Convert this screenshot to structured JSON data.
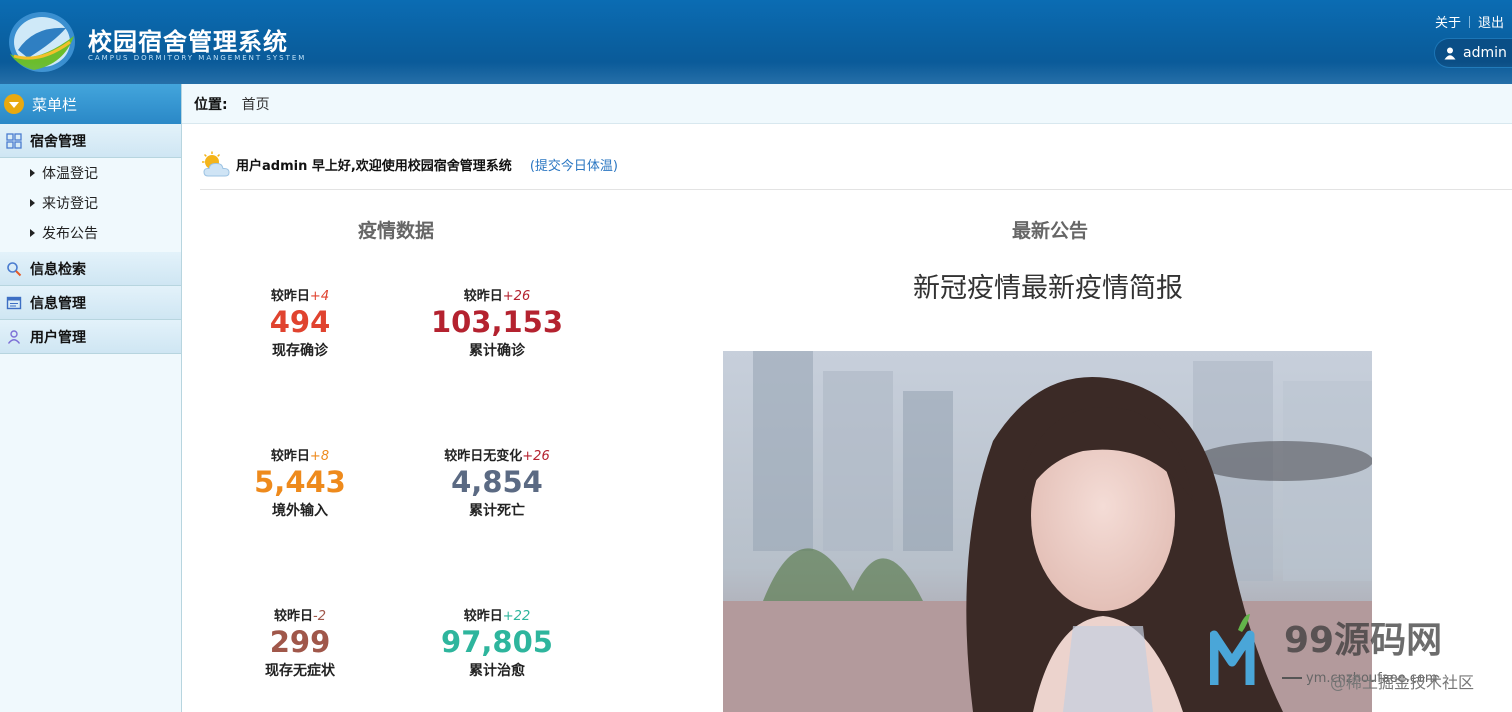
{
  "header": {
    "title": "校园宿舍管理系统",
    "subtitle": "CAMPUS DORMITORY MANGEMENT SYSTEM",
    "links": [
      "关于",
      "退出"
    ],
    "user": "admin"
  },
  "sidebar": {
    "menu_title": "菜单栏",
    "groups": [
      {
        "label": "宿舍管理",
        "items": [
          "体温登记",
          "来访登记",
          "发布公告"
        ]
      },
      {
        "label": "信息检索"
      },
      {
        "label": "信息管理"
      },
      {
        "label": "用户管理"
      }
    ]
  },
  "breadcrumb": {
    "label": "位置:",
    "value": "首页"
  },
  "greeting": {
    "message": "用户admin  早上好,欢迎使用校园宿舍管理系统",
    "link": "(提交今日体温)"
  },
  "epidemic": {
    "title": "疫情数据",
    "stats": [
      {
        "compare": "较昨日",
        "delta": "+4",
        "value": "494",
        "label": "现存确诊",
        "color": "#e0432f",
        "delta_color": "#e0432f"
      },
      {
        "compare": "较昨日",
        "delta": "+26",
        "value": "103,153",
        "label": "累计确诊",
        "color": "#b4222f",
        "delta_color": "#b4222f"
      },
      {
        "compare": "较昨日",
        "delta": "+8",
        "value": "5,443",
        "label": "境外输入",
        "color": "#ee8a1c",
        "delta_color": "#ee8a1c"
      },
      {
        "compare": "较昨日无变化",
        "delta": "+26",
        "value": "4,854",
        "label": "累计死亡",
        "color": "#5b6a83",
        "delta_color": "#b4222f"
      },
      {
        "compare": "较昨日",
        "delta": "-2",
        "value": "299",
        "label": "现存无症状",
        "color": "#a0574a",
        "delta_color": "#a0574a"
      },
      {
        "compare": "较昨日",
        "delta": "+22",
        "value": "97,805",
        "label": "累计治愈",
        "color": "#2eb59d",
        "delta_color": "#2eb59d"
      }
    ]
  },
  "notice": {
    "title": "最新公告",
    "headline": "新冠疫情最新疫情简报"
  },
  "watermark": {
    "brand": "99源码网",
    "site": "ym.cnzhoufaee.com",
    "community": "@稀土掘金技术社区"
  }
}
